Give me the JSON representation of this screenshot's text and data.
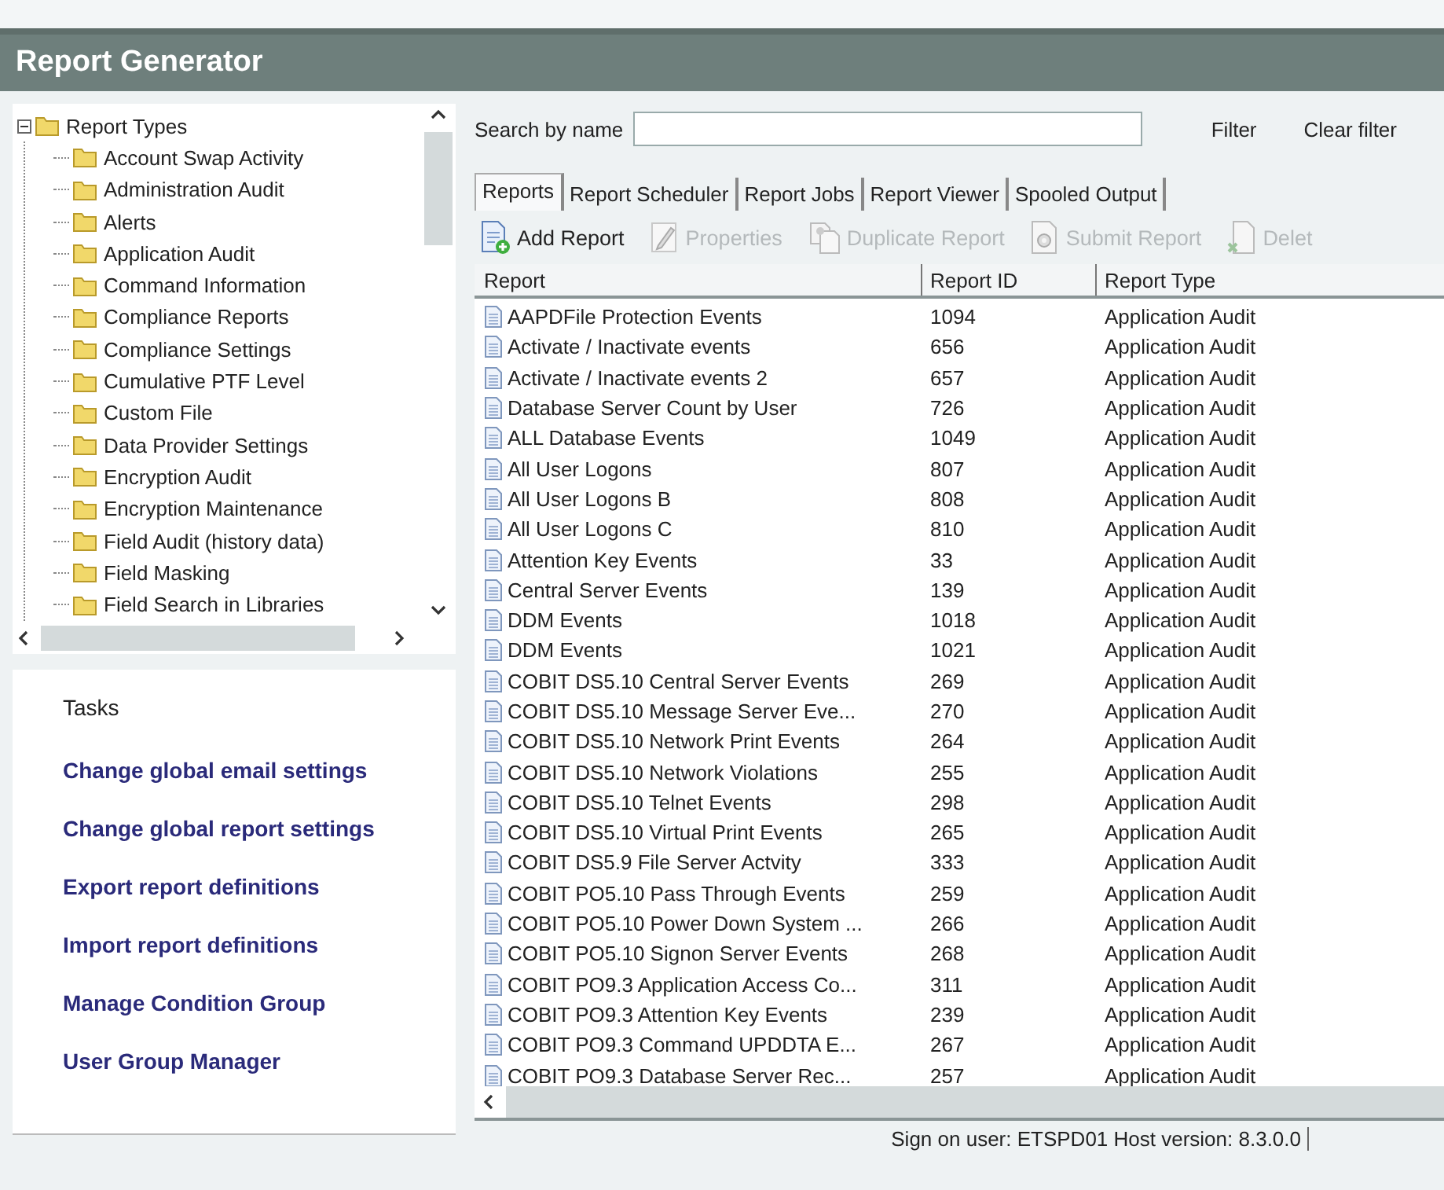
{
  "window": {
    "title": "Report Generator"
  },
  "tree": {
    "label": "Report Types",
    "expanded": true,
    "children": [
      {
        "label": "Account Swap Activity"
      },
      {
        "label": "Administration Audit"
      },
      {
        "label": "Alerts"
      },
      {
        "label": "Application Audit"
      },
      {
        "label": "Command Information"
      },
      {
        "label": "Compliance Reports"
      },
      {
        "label": "Compliance Settings"
      },
      {
        "label": "Cumulative PTF Level"
      },
      {
        "label": "Custom File"
      },
      {
        "label": "Data Provider Settings"
      },
      {
        "label": "Encryption Audit"
      },
      {
        "label": "Encryption Maintenance"
      },
      {
        "label": "Field Audit (history data)"
      },
      {
        "label": "Field Masking"
      },
      {
        "label": "Field Search in Libraries"
      }
    ]
  },
  "tasks": {
    "title": "Tasks",
    "links": [
      "Change global email settings",
      "Change global report settings",
      "Export report definitions",
      "Import report definitions",
      "Manage Condition Group",
      "User Group Manager"
    ]
  },
  "search": {
    "label": "Search by name",
    "filter": "Filter",
    "clear": "Clear filter"
  },
  "tabs": [
    {
      "label": "Reports",
      "selected": true
    },
    {
      "label": "Report Scheduler",
      "selected": false
    },
    {
      "label": "Report Jobs",
      "selected": false
    },
    {
      "label": "Report Viewer",
      "selected": false
    },
    {
      "label": "Spooled Output",
      "selected": false
    }
  ],
  "toolbar": [
    {
      "label": "Add Report",
      "kind": "add",
      "disabled": false
    },
    {
      "label": "Properties",
      "kind": "edit",
      "disabled": true
    },
    {
      "label": "Duplicate Report",
      "kind": "duplicate",
      "disabled": true
    },
    {
      "label": "Submit Report",
      "kind": "submit",
      "disabled": true
    },
    {
      "label": "Delet",
      "kind": "delete",
      "disabled": true
    }
  ],
  "table": {
    "columns": [
      "Report",
      "Report ID",
      "Report Type"
    ],
    "rows": [
      [
        "AAPDFile Protection Events",
        "1094",
        "Application Audit"
      ],
      [
        "Activate / Inactivate events",
        "656",
        "Application Audit"
      ],
      [
        "Activate / Inactivate events 2",
        "657",
        "Application Audit"
      ],
      [
        "Database Server Count by User",
        "726",
        "Application Audit"
      ],
      [
        "ALL Database Events",
        "1049",
        "Application Audit"
      ],
      [
        "All User Logons",
        "807",
        "Application Audit"
      ],
      [
        "All User Logons B",
        "808",
        "Application Audit"
      ],
      [
        "All User Logons C",
        "810",
        "Application Audit"
      ],
      [
        "Attention Key Events",
        "33",
        "Application Audit"
      ],
      [
        "Central Server Events",
        "139",
        "Application Audit"
      ],
      [
        "DDM Events",
        "1018",
        "Application Audit"
      ],
      [
        "DDM Events",
        "1021",
        "Application Audit"
      ],
      [
        "COBIT DS5.10 Central Server Events",
        "269",
        "Application Audit"
      ],
      [
        "COBIT DS5.10 Message Server Eve...",
        "270",
        "Application Audit"
      ],
      [
        "COBIT DS5.10 Network Print Events",
        "264",
        "Application Audit"
      ],
      [
        "COBIT DS5.10 Network Violations",
        "255",
        "Application Audit"
      ],
      [
        "COBIT DS5.10 Telnet Events",
        "298",
        "Application Audit"
      ],
      [
        "COBIT DS5.10 Virtual Print Events",
        "265",
        "Application Audit"
      ],
      [
        "COBIT DS5.9 File Server Actvity",
        "333",
        "Application Audit"
      ],
      [
        "COBIT PO5.10 Pass Through Events",
        "259",
        "Application Audit"
      ],
      [
        "COBIT PO5.10 Power Down System ...",
        "266",
        "Application Audit"
      ],
      [
        "COBIT PO5.10 Signon Server Events",
        "268",
        "Application Audit"
      ],
      [
        "COBIT PO9.3 Application Access Co...",
        "311",
        "Application Audit"
      ],
      [
        "COBIT PO9.3 Attention Key Events",
        "239",
        "Application Audit"
      ],
      [
        "COBIT PO9.3 Command UPDDTA E...",
        "267",
        "Application Audit"
      ],
      [
        "COBIT PO9.3 Database Server Rec...",
        "257",
        "Application Audit"
      ]
    ]
  },
  "status_bar": "Sign on user: ETSPD01 Host version: 8.3.0.0"
}
